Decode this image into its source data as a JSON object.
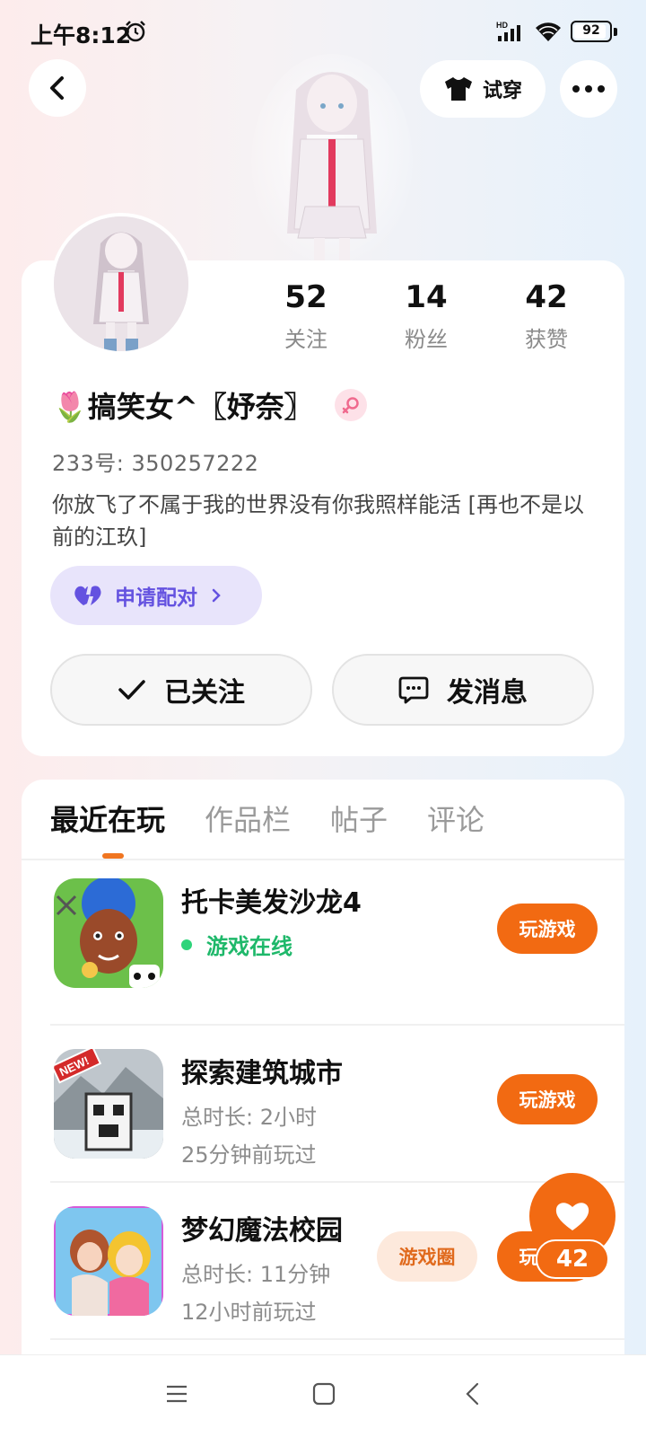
{
  "status_bar": {
    "time": "上午8:12",
    "battery": "92",
    "battery_level": 0.92
  },
  "header": {
    "tryon_label": "试穿"
  },
  "profile": {
    "stats": [
      {
        "value": "52",
        "label": "关注"
      },
      {
        "value": "14",
        "label": "粉丝"
      },
      {
        "value": "42",
        "label": "获赞"
      }
    ],
    "nickname": "🌷搞笑女^〖妤奈〗",
    "user_id": "233号: 350257222",
    "bio": "你放飞了不属于我的世界没有你我照样能活 [再也不是以前的江玖]",
    "match_label": "申请配对",
    "follow_label": "已关注",
    "message_label": "发消息"
  },
  "tabs": [
    "最近在玩",
    "作品栏",
    "帖子",
    "评论"
  ],
  "games": [
    {
      "title": "托卡美发沙龙4",
      "status": "游戏在线",
      "play": "玩游戏"
    },
    {
      "title": "探索建筑城市",
      "duration": "总时长: 2小时",
      "last_played": "25分钟前玩过",
      "play": "玩游戏",
      "badge": "NEW!"
    },
    {
      "title": "梦幻魔法校园",
      "duration": "总时长: 11分钟",
      "last_played": "12小时前玩过",
      "circle": "游戏圈",
      "play": "玩游戏"
    }
  ],
  "like": {
    "count": "42"
  },
  "colors": {
    "accent": "#f26a12",
    "match": "#6452e0",
    "online": "#1eb86a"
  }
}
